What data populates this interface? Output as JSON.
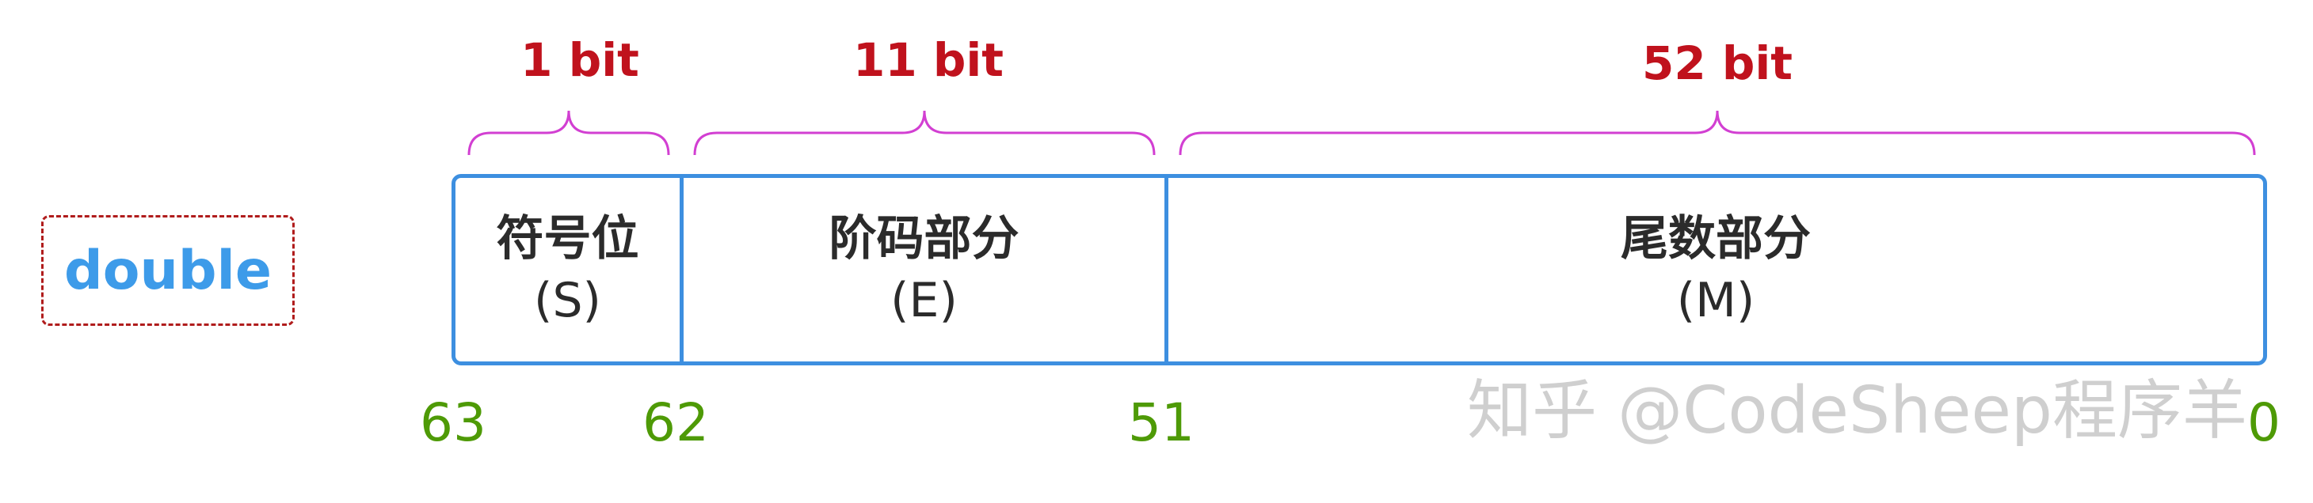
{
  "type_label": "double",
  "fields": [
    {
      "name": "符号位",
      "abbr": "(S)",
      "bits": "1 bit"
    },
    {
      "name": "阶码部分",
      "abbr": "(E)",
      "bits": "11 bit"
    },
    {
      "name": "尾数部分",
      "abbr": "(M)",
      "bits": "52 bit"
    }
  ],
  "positions": [
    "63",
    "62",
    "51",
    "0"
  ],
  "watermark": "知乎 @CodeSheep程序羊",
  "colors": {
    "box_border": "#3d8fe0",
    "type_text": "#3d9be9",
    "type_border": "#b01c1c",
    "bit_label": "#c0121d",
    "brace": "#d23fd2",
    "position": "#4e9a06"
  }
}
